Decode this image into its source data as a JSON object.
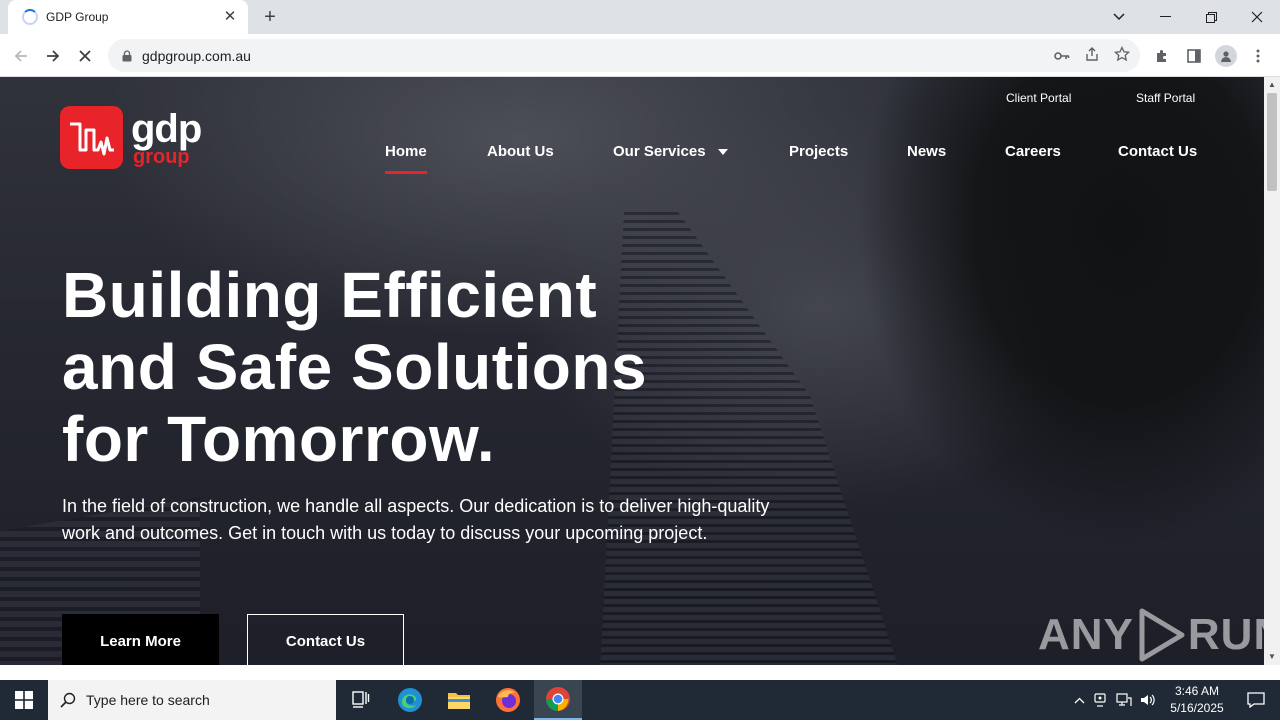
{
  "browser": {
    "tab_title": "GDP Group",
    "tab_close": "✕",
    "new_tab": "+",
    "url": "gdpgroup.com.au",
    "window_controls": {
      "minimize": "—",
      "restore": "❐",
      "close": "✕",
      "tab_search": "⌄"
    }
  },
  "site": {
    "logo": {
      "line1": "gdp",
      "line2": "group"
    },
    "portals": [
      "Client Portal",
      "Staff Portal"
    ],
    "nav": [
      {
        "label": "Home",
        "active": true
      },
      {
        "label": "About Us"
      },
      {
        "label": "Our Services",
        "has_dropdown": true
      },
      {
        "label": "Projects"
      },
      {
        "label": "News"
      },
      {
        "label": "Careers"
      },
      {
        "label": "Contact Us"
      }
    ],
    "headline": [
      "Building Efficient",
      "and Safe Solutions",
      "for Tomorrow."
    ],
    "subtext": "In the field of construction, we handle all aspects. Our dedication is to deliver high-quality work and outcomes. Get in touch with us today to discuss your upcoming project.",
    "buttons": {
      "primary": "Learn More",
      "secondary": "Contact Us"
    },
    "accent_color": "#e8232a"
  },
  "watermark": {
    "left": "ANY",
    "right": "RUN"
  },
  "taskbar": {
    "search_placeholder": "Type here to search",
    "clock_time": "3:46 AM",
    "clock_date": "5/16/2025"
  }
}
